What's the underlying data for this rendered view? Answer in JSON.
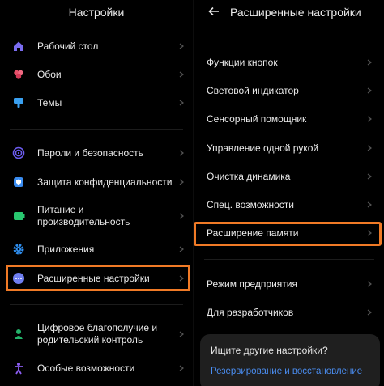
{
  "left_panel": {
    "title": "Настройки",
    "items": [
      {
        "label": "Рабочий стол",
        "icon": "home-icon"
      },
      {
        "label": "Обои",
        "icon": "flower-icon"
      },
      {
        "label": "Темы",
        "icon": "brush-icon"
      },
      {
        "label": "Пароли и безопасность",
        "icon": "fingerprint-icon"
      },
      {
        "label": "Защита конфиденциальности",
        "icon": "privacy-shield-icon"
      },
      {
        "label_line1": "Питание и",
        "label_line2": "производительность",
        "icon": "battery-icon"
      },
      {
        "label": "Приложения",
        "icon": "gear-icon"
      },
      {
        "label": "Расширенные настройки",
        "icon": "more-dots-icon"
      },
      {
        "label_line1": "Цифровое благополучие и",
        "label_line2": "родительский контроль",
        "icon": "wellbeing-icon"
      },
      {
        "label": "Особые возможности",
        "icon": "accessibility-icon"
      }
    ]
  },
  "right_panel": {
    "title": "Расширенные настройки",
    "items": [
      {
        "label": "Функции кнопок"
      },
      {
        "label": "Световой индикатор"
      },
      {
        "label": "Сенсорный помощник"
      },
      {
        "label": "Управление одной рукой"
      },
      {
        "label": "Очистка динамика"
      },
      {
        "label": "Спец. возможности"
      },
      {
        "label": "Расширение памяти"
      },
      {
        "label": "Режим предприятия"
      },
      {
        "label": "Для разработчиков"
      }
    ],
    "search_sheet": {
      "question": "Ищите другие настройки?",
      "link": "Резервирование и восстановление"
    }
  },
  "colors": {
    "background": "#000000",
    "highlight": "#f07a26",
    "link": "#4a8df0",
    "home_icon": "#7a6cf0",
    "wallpaper_icon": "#e8506a",
    "themes_icon": "#3aa0f0",
    "security_icon": "#6c5cf0",
    "privacy_icon": "#3a8cf0",
    "battery_icon": "#28c76f",
    "apps_icon": "#2f8ff0",
    "advanced_icon": "#6f7ef0",
    "wellbeing_icon": "#23b26a",
    "accessibility_icon": "#8a5cf0"
  }
}
